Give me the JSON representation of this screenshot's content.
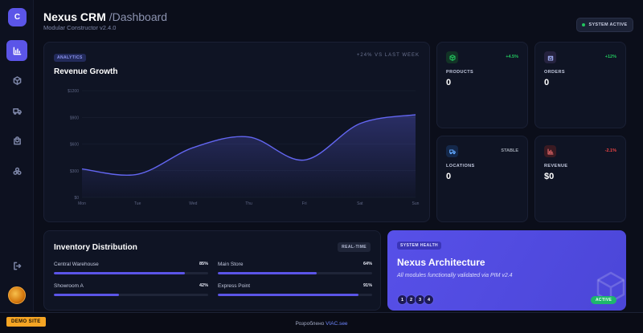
{
  "sidebar": {
    "logo_letter": "C",
    "nav": [
      {
        "icon": "bar-chart-icon",
        "active": true
      },
      {
        "icon": "box-icon",
        "active": false
      },
      {
        "icon": "truck-icon",
        "active": false
      },
      {
        "icon": "shopping-bag-icon",
        "active": false
      },
      {
        "icon": "network-icon",
        "active": false
      }
    ],
    "logout_icon": "logout-icon"
  },
  "header": {
    "app_name": "Nexus CRM",
    "section": "/Dashboard",
    "subtitle": "Modular Constructor v2.4.0",
    "status": "SYSTEM ACTIVE"
  },
  "revenue_card": {
    "tag": "ANALYTICS",
    "title": "Revenue Growth",
    "note": "+24% VS LAST WEEK"
  },
  "chart_data": {
    "type": "area",
    "title": "Revenue Growth",
    "categories": [
      "Mon",
      "Tue",
      "Wed",
      "Thu",
      "Fri",
      "Sat",
      "Sun"
    ],
    "values": [
      320,
      260,
      560,
      680,
      420,
      830,
      930
    ],
    "y_ticks": [
      "$0",
      "$300",
      "$600",
      "$900",
      "$1200"
    ],
    "ylim": [
      0,
      1200
    ],
    "grid": true,
    "series_color": "#6366f1"
  },
  "stats": [
    {
      "label": "PRODUCTS",
      "value": "0",
      "badge": "+4.5%",
      "icon": "cube-icon",
      "color": "#22c55e"
    },
    {
      "label": "ORDERS",
      "value": "0",
      "badge": "+12%",
      "icon": "bag-icon",
      "color": "#22c55e"
    },
    {
      "label": "LOCATIONS",
      "value": "0",
      "badge": "STABLE",
      "icon": "truck-icon",
      "color": "#9ca3af"
    },
    {
      "label": "REVENUE",
      "value": "$0",
      "badge": "-2.1%",
      "icon": "bar-chart-icon",
      "color": "#ef4444"
    }
  ],
  "inventory": {
    "title": "Inventory Distribution",
    "tag": "REAL-TIME",
    "items": [
      {
        "name": "Central Warehouse",
        "pct": "85%",
        "value": 85
      },
      {
        "name": "Main Store",
        "pct": "64%",
        "value": 64
      },
      {
        "name": "Showroom A",
        "pct": "42%",
        "value": 42
      },
      {
        "name": "Express Point",
        "pct": "91%",
        "value": 91
      }
    ]
  },
  "health": {
    "tag": "SYSTEM HEALTH",
    "title": "Nexus Architecture",
    "subtitle": "All modules functionally validated via PIM v2.4",
    "modules": [
      "1",
      "2",
      "3",
      "4"
    ],
    "status": "ACTIVE"
  },
  "footer": {
    "demo": "DEMO SITE",
    "credit": "Розроблено ",
    "credit_link": "VIAC.see"
  }
}
